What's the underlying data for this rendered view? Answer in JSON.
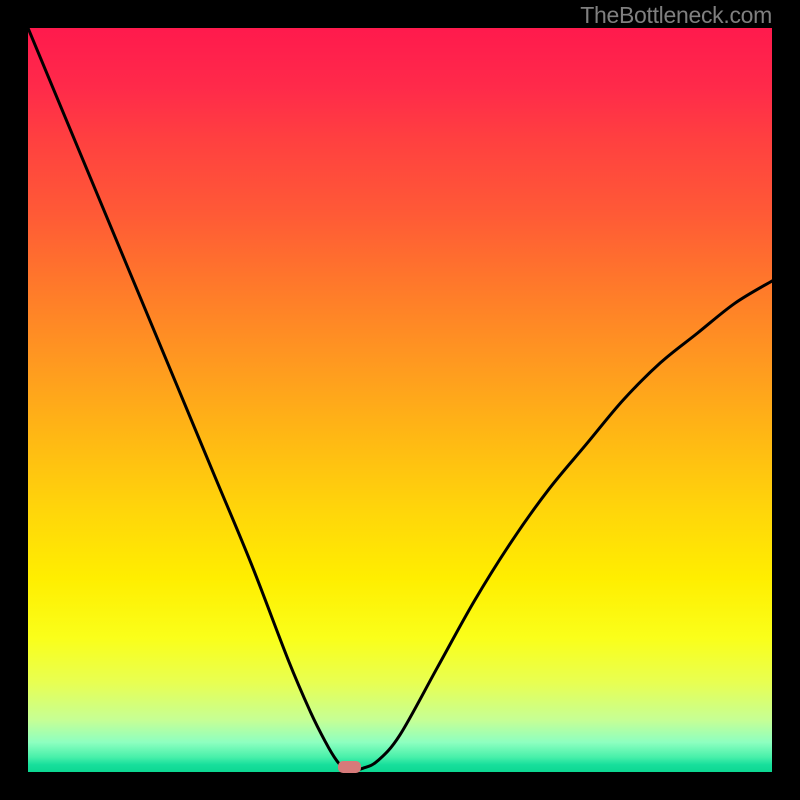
{
  "watermark": "TheBottleneck.com",
  "marker": {
    "cx_frac": 0.432,
    "cy_frac": 0.993
  },
  "chart_data": {
    "type": "line",
    "title": "",
    "xlabel": "",
    "ylabel": "",
    "xlim": [
      0,
      1
    ],
    "ylim": [
      0,
      1
    ],
    "grid": false,
    "background": "rainbow-gradient-vertical",
    "series": [
      {
        "name": "bottleneck-curve",
        "x": [
          0.0,
          0.05,
          0.1,
          0.15,
          0.2,
          0.25,
          0.3,
          0.35,
          0.38,
          0.4,
          0.415,
          0.425,
          0.432,
          0.45,
          0.47,
          0.5,
          0.55,
          0.6,
          0.65,
          0.7,
          0.75,
          0.8,
          0.85,
          0.9,
          0.95,
          1.0
        ],
        "y": [
          1.0,
          0.88,
          0.76,
          0.64,
          0.52,
          0.4,
          0.28,
          0.15,
          0.08,
          0.04,
          0.015,
          0.005,
          0.0,
          0.005,
          0.015,
          0.05,
          0.14,
          0.23,
          0.31,
          0.38,
          0.44,
          0.5,
          0.55,
          0.59,
          0.63,
          0.66
        ]
      }
    ],
    "marker": {
      "x": 0.432,
      "y": 0.007,
      "color": "#d77a7a"
    },
    "gradient_colors": [
      {
        "stop": 0.0,
        "color": "#ff1a4d"
      },
      {
        "stop": 0.25,
        "color": "#ff5a36"
      },
      {
        "stop": 0.5,
        "color": "#ffb814"
      },
      {
        "stop": 0.75,
        "color": "#ffee00"
      },
      {
        "stop": 0.95,
        "color": "#8effc0"
      },
      {
        "stop": 1.0,
        "color": "#0cd892"
      }
    ]
  }
}
